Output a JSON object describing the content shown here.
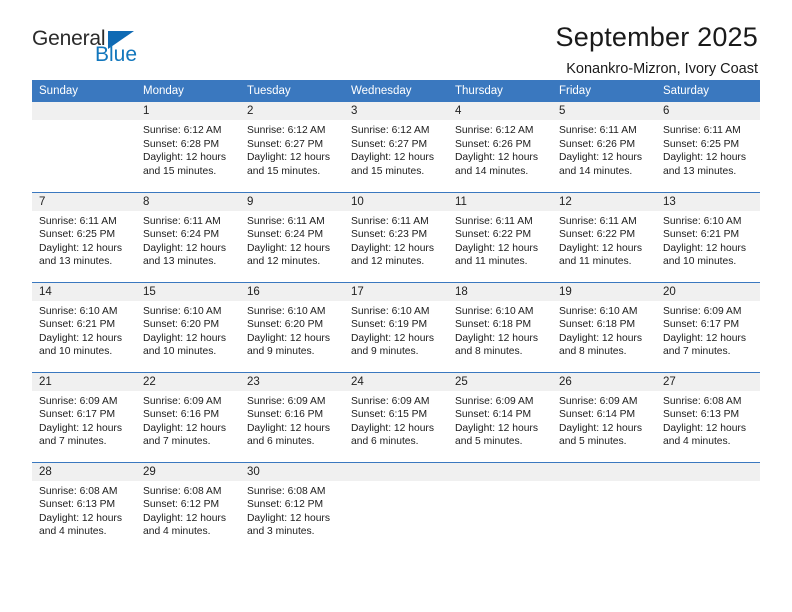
{
  "logo": {
    "word_one": "General",
    "word_two": "Blue",
    "triangle_color": "#0f6ab4",
    "blue_color": "#1277bd"
  },
  "header": {
    "title": "September 2025",
    "subtitle": "Konankro-Mizron, Ivory Coast"
  },
  "theme": {
    "header_blue": "#3a78bf",
    "daynum_bg": "#f0f0f0",
    "text": "#1c1c1c"
  },
  "weekday_headers": [
    "Sunday",
    "Monday",
    "Tuesday",
    "Wednesday",
    "Thursday",
    "Friday",
    "Saturday"
  ],
  "weeks": [
    [
      {
        "day": "",
        "sunrise": "",
        "sunset": "",
        "daylight": ""
      },
      {
        "day": "1",
        "sunrise": "Sunrise: 6:12 AM",
        "sunset": "Sunset: 6:28 PM",
        "daylight": "Daylight: 12 hours and 15 minutes."
      },
      {
        "day": "2",
        "sunrise": "Sunrise: 6:12 AM",
        "sunset": "Sunset: 6:27 PM",
        "daylight": "Daylight: 12 hours and 15 minutes."
      },
      {
        "day": "3",
        "sunrise": "Sunrise: 6:12 AM",
        "sunset": "Sunset: 6:27 PM",
        "daylight": "Daylight: 12 hours and 15 minutes."
      },
      {
        "day": "4",
        "sunrise": "Sunrise: 6:12 AM",
        "sunset": "Sunset: 6:26 PM",
        "daylight": "Daylight: 12 hours and 14 minutes."
      },
      {
        "day": "5",
        "sunrise": "Sunrise: 6:11 AM",
        "sunset": "Sunset: 6:26 PM",
        "daylight": "Daylight: 12 hours and 14 minutes."
      },
      {
        "day": "6",
        "sunrise": "Sunrise: 6:11 AM",
        "sunset": "Sunset: 6:25 PM",
        "daylight": "Daylight: 12 hours and 13 minutes."
      }
    ],
    [
      {
        "day": "7",
        "sunrise": "Sunrise: 6:11 AM",
        "sunset": "Sunset: 6:25 PM",
        "daylight": "Daylight: 12 hours and 13 minutes."
      },
      {
        "day": "8",
        "sunrise": "Sunrise: 6:11 AM",
        "sunset": "Sunset: 6:24 PM",
        "daylight": "Daylight: 12 hours and 13 minutes."
      },
      {
        "day": "9",
        "sunrise": "Sunrise: 6:11 AM",
        "sunset": "Sunset: 6:24 PM",
        "daylight": "Daylight: 12 hours and 12 minutes."
      },
      {
        "day": "10",
        "sunrise": "Sunrise: 6:11 AM",
        "sunset": "Sunset: 6:23 PM",
        "daylight": "Daylight: 12 hours and 12 minutes."
      },
      {
        "day": "11",
        "sunrise": "Sunrise: 6:11 AM",
        "sunset": "Sunset: 6:22 PM",
        "daylight": "Daylight: 12 hours and 11 minutes."
      },
      {
        "day": "12",
        "sunrise": "Sunrise: 6:11 AM",
        "sunset": "Sunset: 6:22 PM",
        "daylight": "Daylight: 12 hours and 11 minutes."
      },
      {
        "day": "13",
        "sunrise": "Sunrise: 6:10 AM",
        "sunset": "Sunset: 6:21 PM",
        "daylight": "Daylight: 12 hours and 10 minutes."
      }
    ],
    [
      {
        "day": "14",
        "sunrise": "Sunrise: 6:10 AM",
        "sunset": "Sunset: 6:21 PM",
        "daylight": "Daylight: 12 hours and 10 minutes."
      },
      {
        "day": "15",
        "sunrise": "Sunrise: 6:10 AM",
        "sunset": "Sunset: 6:20 PM",
        "daylight": "Daylight: 12 hours and 10 minutes."
      },
      {
        "day": "16",
        "sunrise": "Sunrise: 6:10 AM",
        "sunset": "Sunset: 6:20 PM",
        "daylight": "Daylight: 12 hours and 9 minutes."
      },
      {
        "day": "17",
        "sunrise": "Sunrise: 6:10 AM",
        "sunset": "Sunset: 6:19 PM",
        "daylight": "Daylight: 12 hours and 9 minutes."
      },
      {
        "day": "18",
        "sunrise": "Sunrise: 6:10 AM",
        "sunset": "Sunset: 6:18 PM",
        "daylight": "Daylight: 12 hours and 8 minutes."
      },
      {
        "day": "19",
        "sunrise": "Sunrise: 6:10 AM",
        "sunset": "Sunset: 6:18 PM",
        "daylight": "Daylight: 12 hours and 8 minutes."
      },
      {
        "day": "20",
        "sunrise": "Sunrise: 6:09 AM",
        "sunset": "Sunset: 6:17 PM",
        "daylight": "Daylight: 12 hours and 7 minutes."
      }
    ],
    [
      {
        "day": "21",
        "sunrise": "Sunrise: 6:09 AM",
        "sunset": "Sunset: 6:17 PM",
        "daylight": "Daylight: 12 hours and 7 minutes."
      },
      {
        "day": "22",
        "sunrise": "Sunrise: 6:09 AM",
        "sunset": "Sunset: 6:16 PM",
        "daylight": "Daylight: 12 hours and 7 minutes."
      },
      {
        "day": "23",
        "sunrise": "Sunrise: 6:09 AM",
        "sunset": "Sunset: 6:16 PM",
        "daylight": "Daylight: 12 hours and 6 minutes."
      },
      {
        "day": "24",
        "sunrise": "Sunrise: 6:09 AM",
        "sunset": "Sunset: 6:15 PM",
        "daylight": "Daylight: 12 hours and 6 minutes."
      },
      {
        "day": "25",
        "sunrise": "Sunrise: 6:09 AM",
        "sunset": "Sunset: 6:14 PM",
        "daylight": "Daylight: 12 hours and 5 minutes."
      },
      {
        "day": "26",
        "sunrise": "Sunrise: 6:09 AM",
        "sunset": "Sunset: 6:14 PM",
        "daylight": "Daylight: 12 hours and 5 minutes."
      },
      {
        "day": "27",
        "sunrise": "Sunrise: 6:08 AM",
        "sunset": "Sunset: 6:13 PM",
        "daylight": "Daylight: 12 hours and 4 minutes."
      }
    ],
    [
      {
        "day": "28",
        "sunrise": "Sunrise: 6:08 AM",
        "sunset": "Sunset: 6:13 PM",
        "daylight": "Daylight: 12 hours and 4 minutes."
      },
      {
        "day": "29",
        "sunrise": "Sunrise: 6:08 AM",
        "sunset": "Sunset: 6:12 PM",
        "daylight": "Daylight: 12 hours and 4 minutes."
      },
      {
        "day": "30",
        "sunrise": "Sunrise: 6:08 AM",
        "sunset": "Sunset: 6:12 PM",
        "daylight": "Daylight: 12 hours and 3 minutes."
      },
      {
        "day": "",
        "sunrise": "",
        "sunset": "",
        "daylight": ""
      },
      {
        "day": "",
        "sunrise": "",
        "sunset": "",
        "daylight": ""
      },
      {
        "day": "",
        "sunrise": "",
        "sunset": "",
        "daylight": ""
      },
      {
        "day": "",
        "sunrise": "",
        "sunset": "",
        "daylight": ""
      }
    ]
  ]
}
